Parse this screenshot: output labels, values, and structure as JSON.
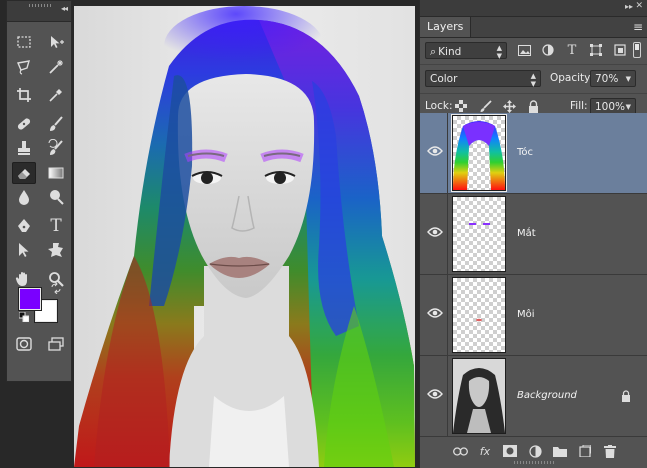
{
  "colors": {
    "foreground": "#7a00ff",
    "background": "#ffffff",
    "selected_layer": "#6b7f9c",
    "panel": "#535353"
  },
  "tools_panel": {
    "collapse_glyph": "◂◂",
    "tools": [
      [
        "rectangular-marquee-icon",
        "move-icon"
      ],
      [
        "lasso-icon",
        "magic-wand-icon"
      ],
      [
        "crop-icon",
        "eyedropper-icon"
      ],
      [
        "healing-brush-icon",
        "brush-icon"
      ],
      [
        "clone-stamp-icon",
        "history-brush-icon"
      ],
      [
        "eraser-icon",
        "gradient-icon"
      ],
      [
        "blur-icon",
        "dodge-icon"
      ],
      [
        "pen-icon",
        "type-icon"
      ],
      [
        "path-selection-icon",
        "shape-icon"
      ],
      [
        "hand-icon",
        "zoom-icon"
      ]
    ],
    "type_tool_glyph": "T",
    "active_tool": "eraser-icon"
  },
  "layers_panel": {
    "collapse_glyph": "▸▸",
    "close_glyph": "✕",
    "tab_label": "Layers",
    "menu_glyph": "≡",
    "filter": {
      "value": "Kind",
      "glyph": "⌕"
    },
    "filter_icons": [
      "image-filter-icon",
      "adjustment-filter-icon",
      "type-filter-icon",
      "shape-filter-icon",
      "smart-object-filter-icon"
    ],
    "type_filter_glyph": "T",
    "blend_mode": "Color",
    "opacity_label": "Opacity:",
    "opacity_value": "70%",
    "lock_label": "Lock:",
    "fill_label": "Fill:",
    "fill_value": "100%",
    "layers": [
      {
        "name": "Tóc",
        "selected": true,
        "visible": true
      },
      {
        "name": "Mắt",
        "selected": false,
        "visible": true
      },
      {
        "name": "Môi",
        "selected": false,
        "visible": true
      },
      {
        "name": "Background",
        "selected": false,
        "visible": true,
        "locked": true
      }
    ],
    "bottom_icons": [
      "link-layers-icon",
      "fx-icon",
      "add-mask-icon",
      "new-adjustment-icon",
      "new-group-icon",
      "new-layer-icon",
      "delete-layer-icon"
    ],
    "fx_label": "fx"
  }
}
